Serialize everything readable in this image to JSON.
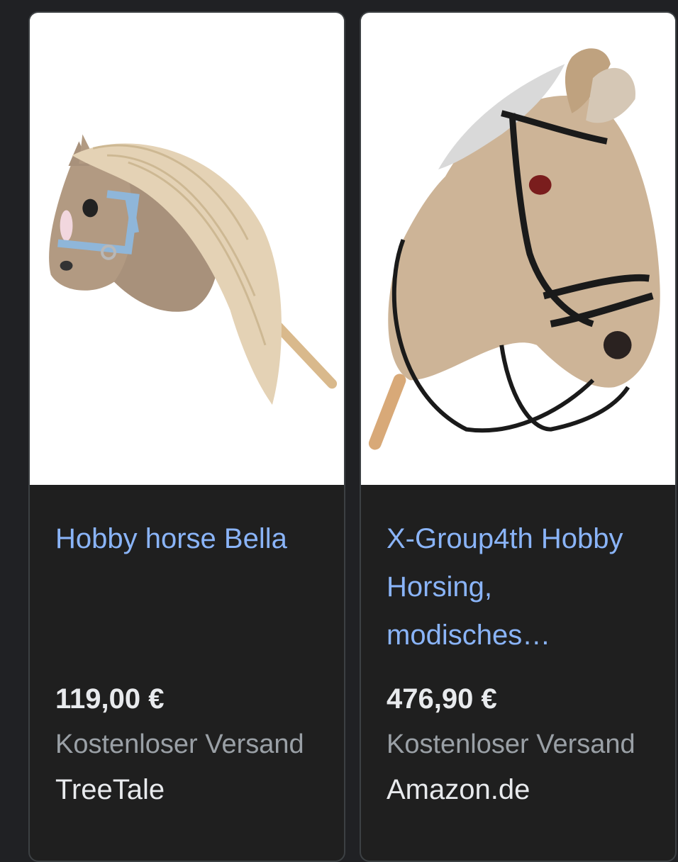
{
  "products": [
    {
      "title": "Hobby horse Bella",
      "price": "119,00 €",
      "shipping": "Kostenloser Versand",
      "seller": "TreeTale"
    },
    {
      "title": "X-Group4th Hobby Horsing, modisches…",
      "price": "476,90 €",
      "shipping": "Kostenloser Versand",
      "seller": "Amazon.de"
    }
  ],
  "colors": {
    "background": "#202124",
    "card_background": "#1f1f1f",
    "card_border": "#3c4043",
    "title_link": "#8ab4f8",
    "price_text": "#e8eaed",
    "shipping_text": "#9aa0a6"
  }
}
